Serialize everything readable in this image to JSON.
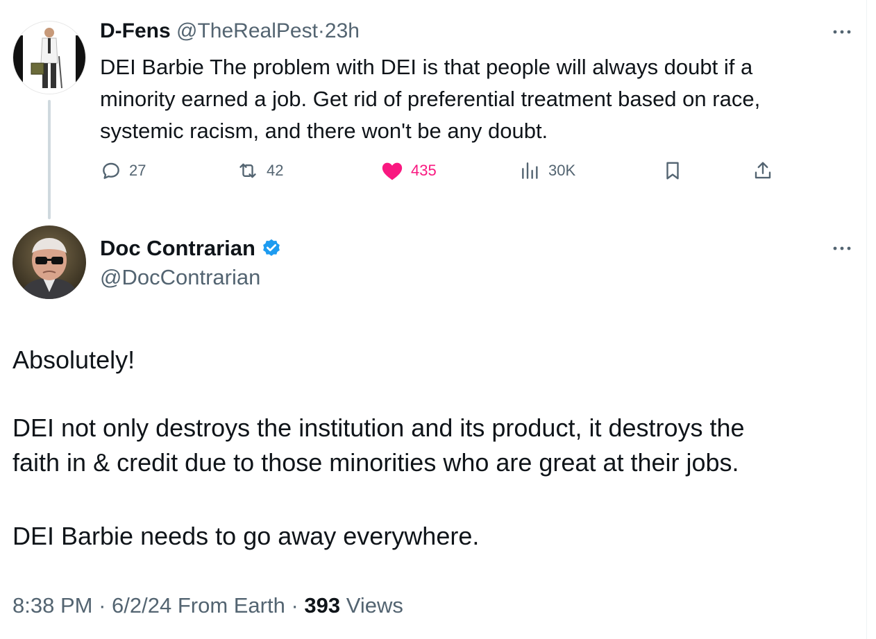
{
  "parent_tweet": {
    "author_name": "D-Fens",
    "author_handle": "@TheRealPest",
    "separator": "·",
    "time": "23h",
    "text_lines": [
      "DEI Barbie The problem with DEI is that people will always doubt if a",
      "minority earned a job. Get rid of preferential treatment based on race,",
      "systemic racism, and there won't be any doubt."
    ],
    "actions": {
      "replies": "27",
      "retweets": "42",
      "likes": "435",
      "views": "30K"
    },
    "like_color": "#f91880"
  },
  "main_tweet": {
    "author_name": "Doc Contrarian",
    "author_handle": "@DocContrarian",
    "verified": true,
    "verified_color": "#1d9bf0",
    "paragraphs": {
      "p1": "Absolutely!",
      "p2_line1": "DEI not only destroys the institution and its product, it destroys the",
      "p2_line2": "faith in & credit due to those minorities who are great at their jobs.",
      "p3": "DEI Barbie needs to go away everywhere."
    },
    "meta": {
      "time": "8:38 PM",
      "date_source": "· 6/2/24 From Earth ·",
      "views_count": "393",
      "views_label": "Views"
    }
  },
  "icons": [
    "more-icon",
    "reply-icon",
    "retweet-icon",
    "like-icon",
    "views-icon",
    "bookmark-icon",
    "share-icon",
    "verified-badge-icon"
  ]
}
